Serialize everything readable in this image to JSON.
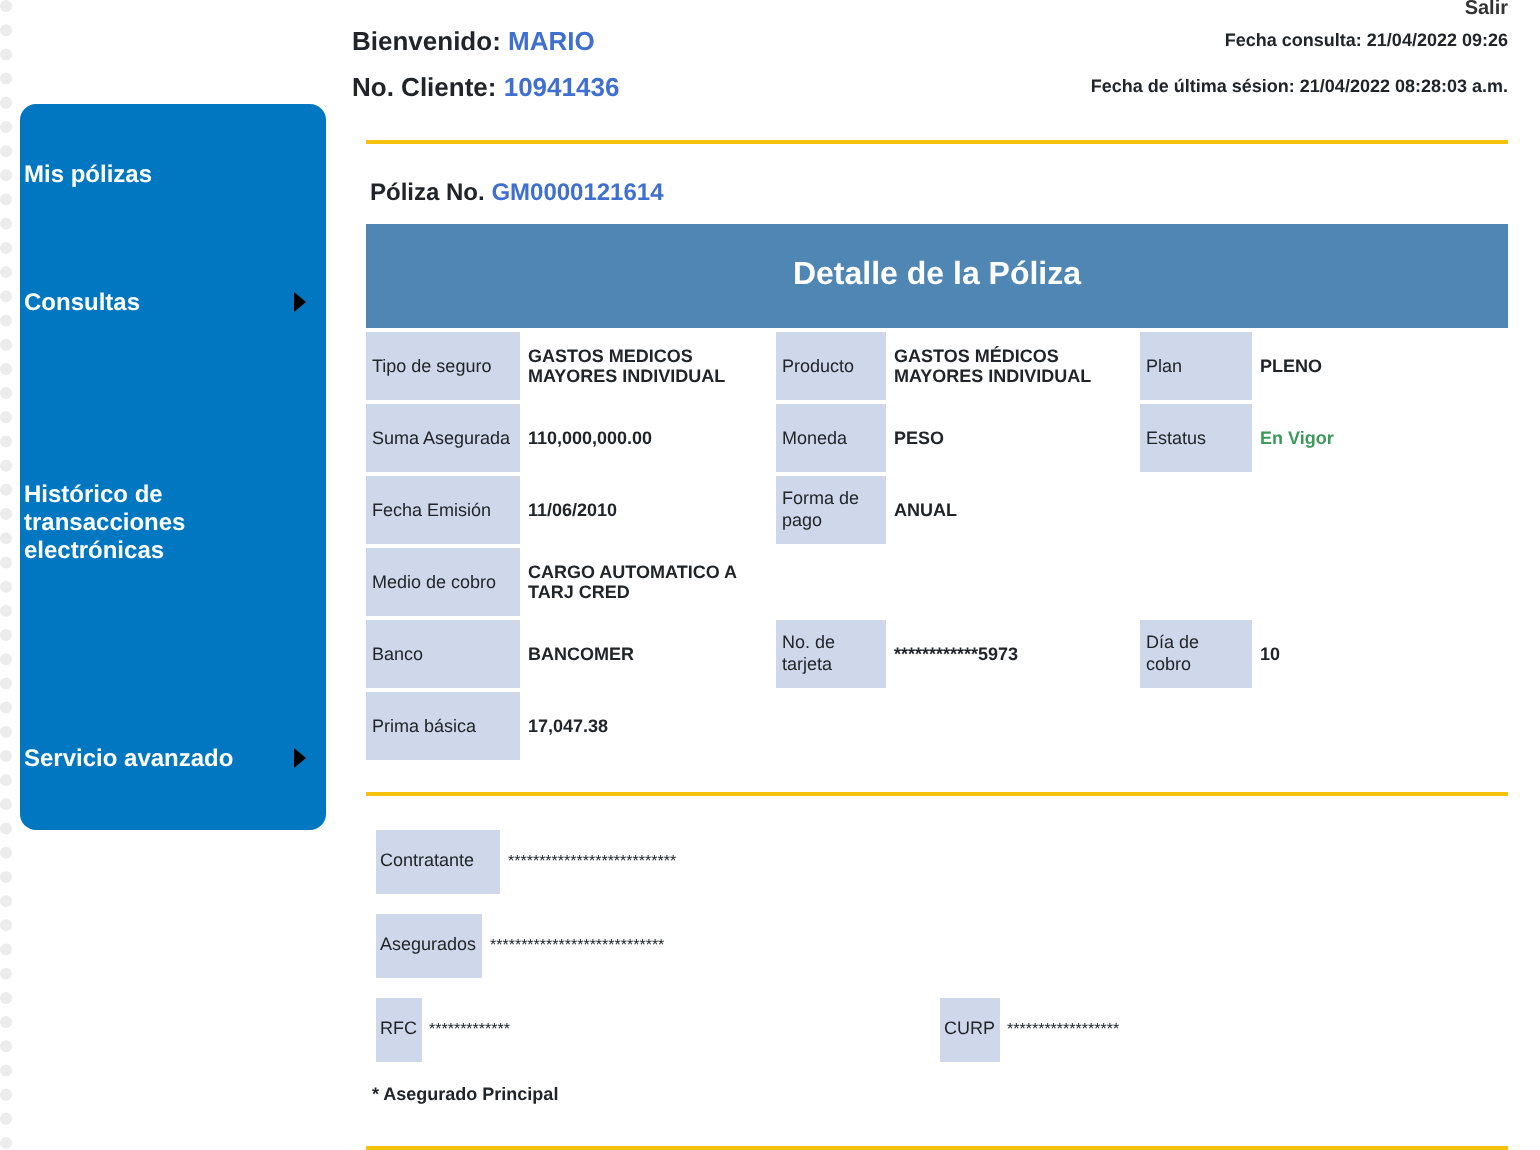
{
  "header": {
    "logout": "Salir",
    "welcome_label": "Bienvenido:",
    "user_name": "MARIO",
    "client_label": "No. Cliente:",
    "client_number": "10941436",
    "query_date": "Fecha consulta: 21/04/2022 09:26",
    "last_session": "Fecha de última sésion: 21/04/2022 08:28:03 a.m."
  },
  "sidebar": {
    "items": [
      {
        "label": "Mis pólizas",
        "has_submenu": false
      },
      {
        "label": "Consultas",
        "has_submenu": true
      },
      {
        "label": "Histórico de transacciones electrónicas",
        "has_submenu": false
      },
      {
        "label": "Servicio avanzado",
        "has_submenu": true
      }
    ]
  },
  "policy": {
    "label": "Póliza No.",
    "number": "GM0000121614",
    "title": "Detalle de la Póliza",
    "rows": [
      [
        {
          "label": "Tipo de seguro",
          "value": "GASTOS MEDICOS MAYORES INDIVIDUAL",
          "kind": "text"
        },
        {
          "label": "Producto",
          "value": "GASTOS MÉDICOS MAYORES INDIVIDUAL",
          "kind": "text"
        },
        {
          "label": "Plan",
          "value": "PLENO",
          "kind": "text"
        }
      ],
      [
        {
          "label": "Suma Asegurada",
          "value": "110,000,000.00",
          "kind": "text"
        },
        {
          "label": "Moneda",
          "value": "PESO",
          "kind": "text"
        },
        {
          "label": "Estatus",
          "value": "En Vigor",
          "kind": "status"
        }
      ],
      [
        {
          "label": "Fecha Emisión",
          "value": "11/06/2010",
          "kind": "text"
        },
        {
          "label": "Forma de pago",
          "value": "ANUAL",
          "kind": "text"
        }
      ],
      [
        {
          "label": "Medio de cobro",
          "value": "CARGO AUTOMATICO A TARJ CRED",
          "kind": "text"
        }
      ],
      [
        {
          "label": "Banco",
          "value": "BANCOMER",
          "kind": "text"
        },
        {
          "label": "No. de tarjeta",
          "value": "************5973",
          "kind": "text"
        },
        {
          "label": "Día de cobro",
          "value": "10",
          "kind": "text"
        }
      ],
      [
        {
          "label": "Prima básica",
          "value": "17,047.38",
          "kind": "text"
        }
      ]
    ]
  },
  "insured": {
    "contractor": {
      "label": "Contratante",
      "value": "***************************"
    },
    "insured": {
      "label": "Asegurados",
      "value": "****************************"
    },
    "rfc": {
      "label": "RFC",
      "value": "*************"
    },
    "curp": {
      "label": "CURP",
      "value": "******************"
    },
    "note": "* Asegurado Principal"
  }
}
